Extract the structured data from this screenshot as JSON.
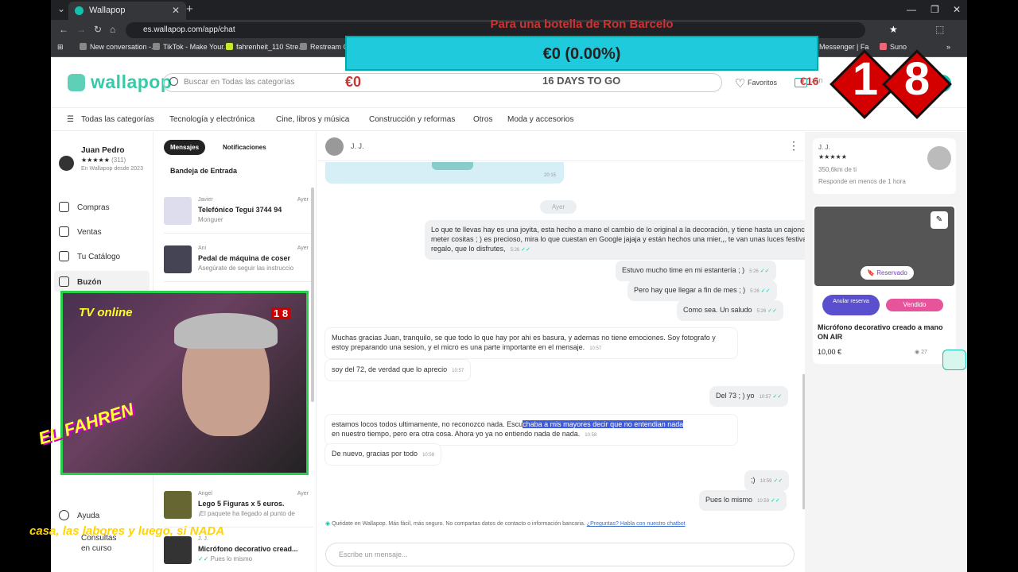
{
  "browser": {
    "tab_title": "Wallapop",
    "url": "es.wallapop.com/app/chat",
    "bookmarks": [
      "New conversation -...",
      "TikTok - Make Your...",
      "fahrenheit_110 Stre...",
      "Restream Chat",
      "Messenger | Fa",
      "Suno"
    ]
  },
  "header": {
    "logo": "wallapop",
    "search_placeholder": "Buscar en Todas las categorías",
    "favoritos": "Favoritos",
    "buzon_partial": "zón"
  },
  "categories": [
    "Todas las categorías",
    "Tecnología y electrónica",
    "Cine, libros y música",
    "Construcción y reformas",
    "Otros",
    "Moda y accesorios"
  ],
  "sidebar": {
    "user_name": "Juan Pedro",
    "rating_count": "(311)",
    "since": "En Wallapop desde 2023",
    "items": [
      "Compras",
      "Ventas",
      "Tu Catálogo",
      "Buzón",
      "Ayuda",
      "Consultas en curso"
    ]
  },
  "inbox": {
    "tab_messages": "Mensajes",
    "tab_notifications": "Notificaciones",
    "section": "Bandeja de Entrada",
    "conversations": [
      {
        "who": "Javier",
        "day": "Ayer",
        "title": "Telefónico Tegui 3744 94",
        "sub": "Monguer"
      },
      {
        "who": "Ani",
        "day": "Ayer",
        "title": "Pedal de máquina de coser",
        "sub": "Asegúrate de seguir las instruccio"
      },
      {
        "who": "Angel",
        "day": "Ayer",
        "title": "Lego 5 Figuras x 5 euros.",
        "sub": "¡El paquete ha llegado al punto de"
      },
      {
        "who": "J. J.",
        "day": "",
        "title": "Micrófono decorativo cread...",
        "sub": "Pues lo mismo"
      }
    ]
  },
  "chat": {
    "contact": "J. J.",
    "separator": "Ayer",
    "top_time": "20:15",
    "messages": [
      {
        "text": "Lo que te llevas hay es una joyita, esta hecho a mano el cambio de lo original a la decoración, y tiene hasta un cajoncito para meter cositas ; ) es precioso, mira lo que cuestan en Google jajaja y están hechos una mier,,, te van unas luces festivas de regalo, que lo disfrutes,",
        "time": "5:26"
      },
      {
        "text": "Estuvo mucho time en mi estantería ; )",
        "time": "5:26"
      },
      {
        "text": "Pero hay que llegar a fin de mes ; )",
        "time": "5:26"
      },
      {
        "text": "Como sea. Un saludo",
        "time": "5:26"
      },
      {
        "text": "Muchas gracias Juan, tranquilo, se que todo lo que hay por ahi es basura, y ademas no tiene emociones. Soy fotografo y estoy preparando una sesion, y el micro es una parte importante en el mensaje.",
        "time": "10:57"
      },
      {
        "text": "soy del 72, de verdad que lo aprecio",
        "time": "10:57"
      },
      {
        "text": "Del 73 ; ) yo",
        "time": "10:57"
      },
      {
        "text_a": "estamos locos todos ultimamente, no reconozco nada. Escu",
        "text_hl": "chaba a mis mayores decir que no entendian nada",
        "text_b": "en nuestro tiempo, pero era otra cosa. Ahora yo ya no entiendo nada de nada.",
        "time": "10:58"
      },
      {
        "text": "De nuevo, gracias por todo",
        "time": "10:58"
      },
      {
        "text": ";)",
        "time": "10:59"
      },
      {
        "text": "Pues lo mismo",
        "time": "10:59"
      }
    ],
    "notice": "Quédate en Wallapop. Más fácil, más seguro. No compartas datos de contacto o información bancaria.",
    "notice_link": "¿Preguntas? Habla con nuestro chatbot",
    "input_placeholder": "Escribe un mensaje..."
  },
  "right_panel": {
    "contact": "J. J.",
    "distance": "350,6km de ti",
    "response": "Responde en menos de 1 hora",
    "reserved_badge": "Reservado",
    "cancel_btn": "Anular reserva",
    "sold_btn": "Vendido",
    "product_title": "Micrófono decorativo creado a mano ON AIR",
    "price": "10,00 €",
    "views": "27"
  },
  "overlay": {
    "ron": "Para una botella de Ron Barcelo",
    "counter": "€0 (0.00%)",
    "euro_left": "€0",
    "days": "16 DAYS TO GO",
    "euro_right": "€16",
    "digits": [
      "1",
      "8"
    ],
    "tv_online": "TV online",
    "el_fahren": "EL FAHREN",
    "scroll_text": "casa, las labores y luego, si NADA"
  },
  "colors": {
    "brand": "#13c1ac",
    "reserve_purple": "#6c4cd6",
    "sold_pink": "#e8549c",
    "highlight": "#3d5ae0"
  }
}
